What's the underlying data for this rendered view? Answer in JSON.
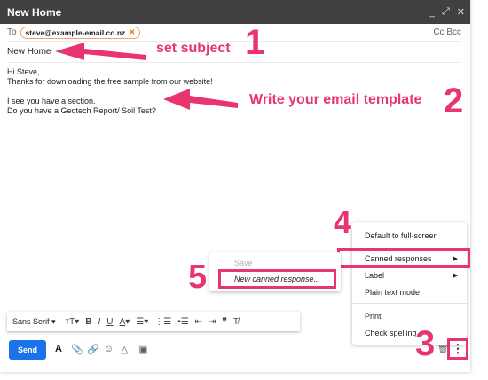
{
  "window": {
    "title": "New Home",
    "controls": [
      "_",
      "⤢",
      "✕"
    ]
  },
  "recipients": {
    "to_label": "To",
    "to_chip": "steve@example-email.co.nz",
    "cc_bcc": "Cc Bcc"
  },
  "subject": "New Home",
  "body_lines": [
    "Hi Steve,",
    "Thanks for downloading the free sample from our website!",
    "",
    "I see you have a section.",
    "Do you have a Geotech Report/ Soil Test?"
  ],
  "annotations": {
    "step1_label": "set subject",
    "step1_num": "1",
    "step2_label": "Write your email template",
    "step2_num": "2",
    "step3_num": "3",
    "step4_num": "4",
    "step5_num": "5",
    "color": "#e8356d"
  },
  "more_menu": {
    "items": [
      "Default to full-screen",
      "Canned responses",
      "Label",
      "Plain text mode",
      "Print",
      "Check spelling"
    ]
  },
  "canned_menu": {
    "items": [
      "Save",
      "New canned response..."
    ]
  },
  "format_toolbar": {
    "font": "Sans Serif"
  },
  "send_label": "Send"
}
